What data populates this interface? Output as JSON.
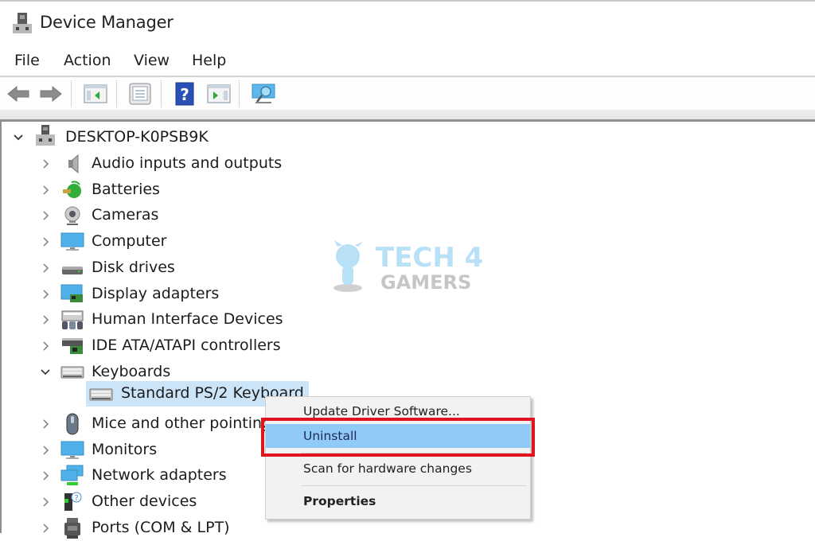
{
  "window": {
    "title": "Device Manager",
    "icon": "device-manager-icon"
  },
  "menubar": {
    "items": [
      {
        "label": "File"
      },
      {
        "label": "Action"
      },
      {
        "label": "View"
      },
      {
        "label": "Help"
      }
    ]
  },
  "toolbar": {
    "buttons": [
      {
        "name": "back",
        "icon": "arrow-left-icon"
      },
      {
        "name": "forward",
        "icon": "arrow-right-icon"
      },
      {
        "name": "show-hide-console-tree",
        "icon": "console-tree-icon"
      },
      {
        "name": "properties",
        "icon": "properties-icon"
      },
      {
        "name": "help",
        "icon": "help-icon"
      },
      {
        "name": "show-hide-action-pane",
        "icon": "action-pane-icon"
      },
      {
        "name": "scan-hardware",
        "icon": "monitor-scan-icon"
      }
    ]
  },
  "tree": {
    "root": {
      "label": "DESKTOP-K0PSB9K",
      "expanded": true,
      "icon": "computer-tower-icon"
    },
    "categories": [
      {
        "label": "Audio inputs and outputs",
        "icon": "speaker-icon",
        "expanded": false
      },
      {
        "label": "Batteries",
        "icon": "battery-icon",
        "expanded": false
      },
      {
        "label": "Cameras",
        "icon": "webcam-icon",
        "expanded": false
      },
      {
        "label": "Computer",
        "icon": "monitor-icon",
        "expanded": false
      },
      {
        "label": "Disk drives",
        "icon": "disk-drive-icon",
        "expanded": false
      },
      {
        "label": "Display adapters",
        "icon": "display-adapter-icon",
        "expanded": false
      },
      {
        "label": "Human Interface Devices",
        "icon": "hid-icon",
        "expanded": false
      },
      {
        "label": "IDE ATA/ATAPI controllers",
        "icon": "ide-controller-icon",
        "expanded": false
      },
      {
        "label": "Keyboards",
        "icon": "keyboard-icon",
        "expanded": true
      },
      {
        "label": "Mice and other pointing devices",
        "icon": "mouse-icon",
        "expanded": false
      },
      {
        "label": "Monitors",
        "icon": "monitor-icon",
        "expanded": false
      },
      {
        "label": "Network adapters",
        "icon": "network-adapter-icon",
        "expanded": false
      },
      {
        "label": "Other devices",
        "icon": "unknown-device-icon",
        "expanded": false
      },
      {
        "label": "Ports (COM & LPT)",
        "icon": "port-icon",
        "expanded": false
      }
    ],
    "selected_child": {
      "label": "Standard PS/2 Keyboard",
      "parent": "Keyboards",
      "icon": "keyboard-icon"
    }
  },
  "context_menu": {
    "items": [
      {
        "label": "Update Driver Software...",
        "highlighted": false,
        "bold": false
      },
      {
        "label": "Uninstall",
        "highlighted": true,
        "bold": false
      },
      {
        "label": "Scan for hardware changes",
        "highlighted": false,
        "bold": false
      },
      {
        "label": "Properties",
        "highlighted": false,
        "bold": true
      }
    ],
    "annotation_color": "#e0141e"
  },
  "watermark": {
    "line1": "TECH 4",
    "line2": "GAMERS"
  },
  "colors": {
    "selection": "#cce4f7",
    "menu_highlight": "#91c9f7",
    "menu_bg": "#f2f2f2"
  }
}
